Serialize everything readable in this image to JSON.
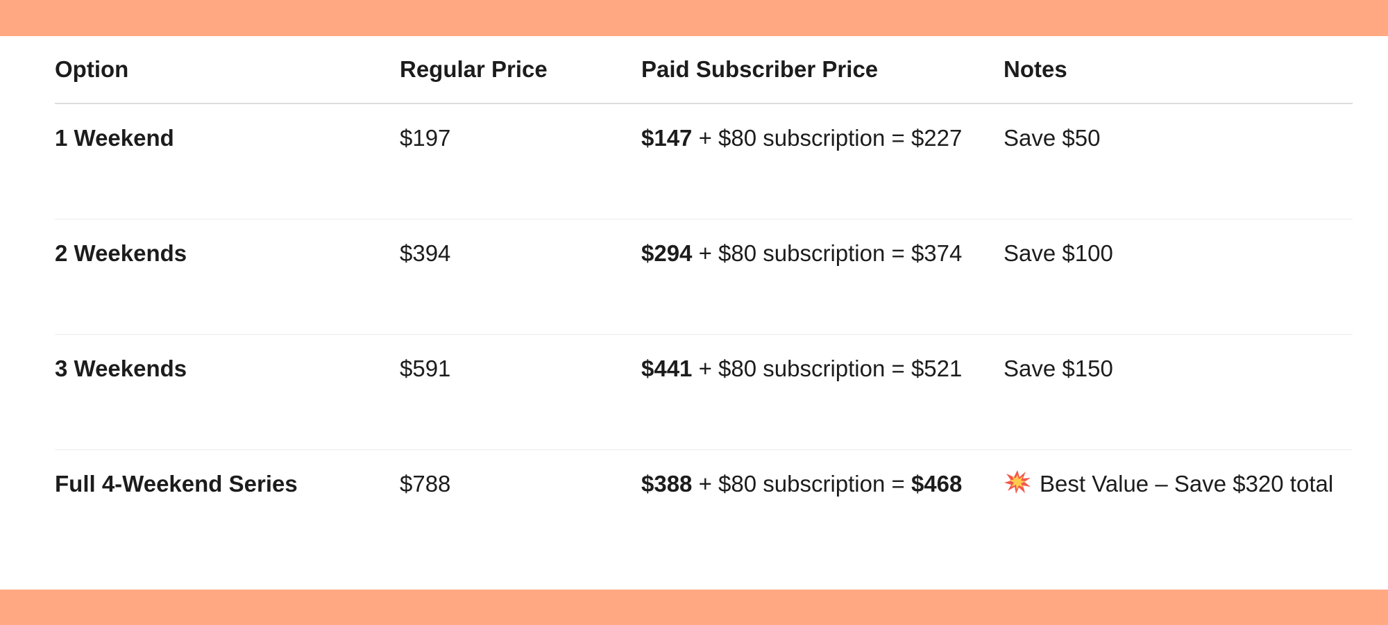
{
  "theme": {
    "band_color": "#ffa882",
    "text_color": "#1c1c1c"
  },
  "table": {
    "headers": {
      "option": "Option",
      "regular": "Regular Price",
      "subscriber": "Paid Subscriber Price",
      "notes": "Notes"
    },
    "rows": [
      {
        "option": "1 Weekend",
        "regular": "$197",
        "sub_price": "$147",
        "sub_middle": " + $80 subscription = ",
        "sub_total": "$227",
        "total_bold": false,
        "notes": "Save $50"
      },
      {
        "option": "2 Weekends",
        "regular": "$394",
        "sub_price": "$294",
        "sub_middle": " + $80 subscription = ",
        "sub_total": "$374",
        "total_bold": false,
        "notes": "Save $100"
      },
      {
        "option": "3 Weekends",
        "regular": "$591",
        "sub_price": "$441",
        "sub_middle": " + $80 subscription = ",
        "sub_total": "$521",
        "total_bold": false,
        "notes": "Save $150"
      },
      {
        "option": "Full 4-Weekend Series",
        "regular": "$788",
        "sub_price": "$388",
        "sub_middle": " + $80 subscription = ",
        "sub_total": "$468",
        "total_bold": true,
        "notes": "Best Value – Save $320 total",
        "notes_icon": "collision-icon"
      }
    ]
  }
}
